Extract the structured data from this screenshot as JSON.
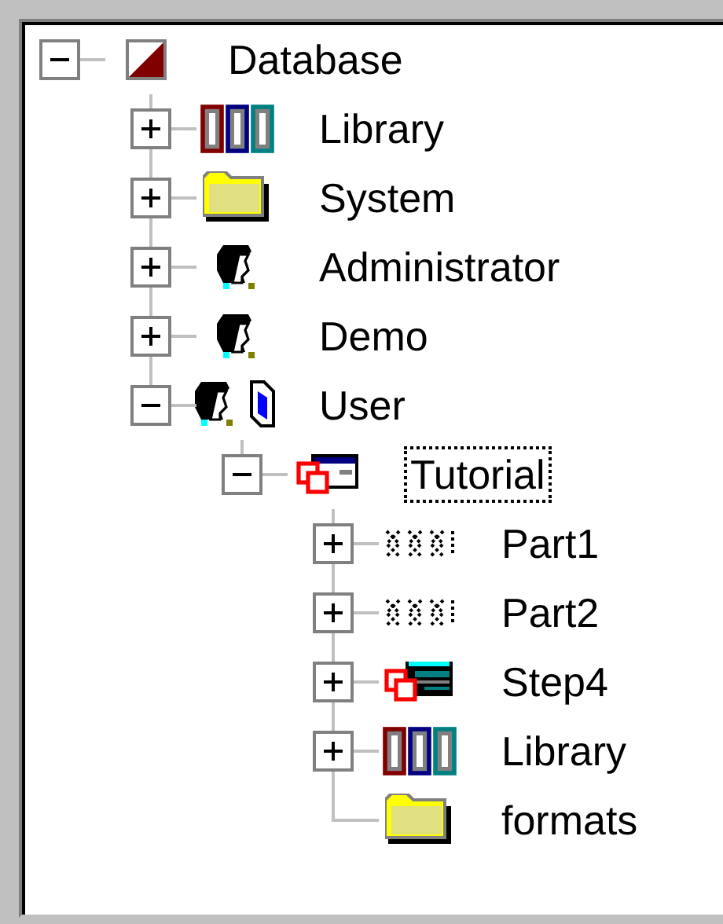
{
  "tree": [
    {
      "label": "Database",
      "kind": "database",
      "expanded": true,
      "selected": false,
      "children": [
        {
          "label": "Library",
          "kind": "library",
          "expanded": false,
          "selected": false
        },
        {
          "label": "System",
          "kind": "folder",
          "expanded": false,
          "selected": false
        },
        {
          "label": "Administrator",
          "kind": "person",
          "expanded": false,
          "selected": false
        },
        {
          "label": "Demo",
          "kind": "person",
          "expanded": false,
          "selected": false
        },
        {
          "label": "User",
          "kind": "user",
          "expanded": true,
          "selected": false,
          "children": [
            {
              "label": "Tutorial",
              "kind": "project",
              "expanded": true,
              "selected": true,
              "children": [
                {
                  "label": "Part1",
                  "kind": "pattern",
                  "expanded": false,
                  "selected": false
                },
                {
                  "label": "Part2",
                  "kind": "pattern",
                  "expanded": false,
                  "selected": false
                },
                {
                  "label": "Step4",
                  "kind": "form",
                  "expanded": false,
                  "selected": false
                },
                {
                  "label": "Library",
                  "kind": "library",
                  "expanded": false,
                  "selected": false
                },
                {
                  "label": "formats",
                  "kind": "folder",
                  "selected": false
                }
              ]
            }
          ]
        }
      ]
    }
  ]
}
